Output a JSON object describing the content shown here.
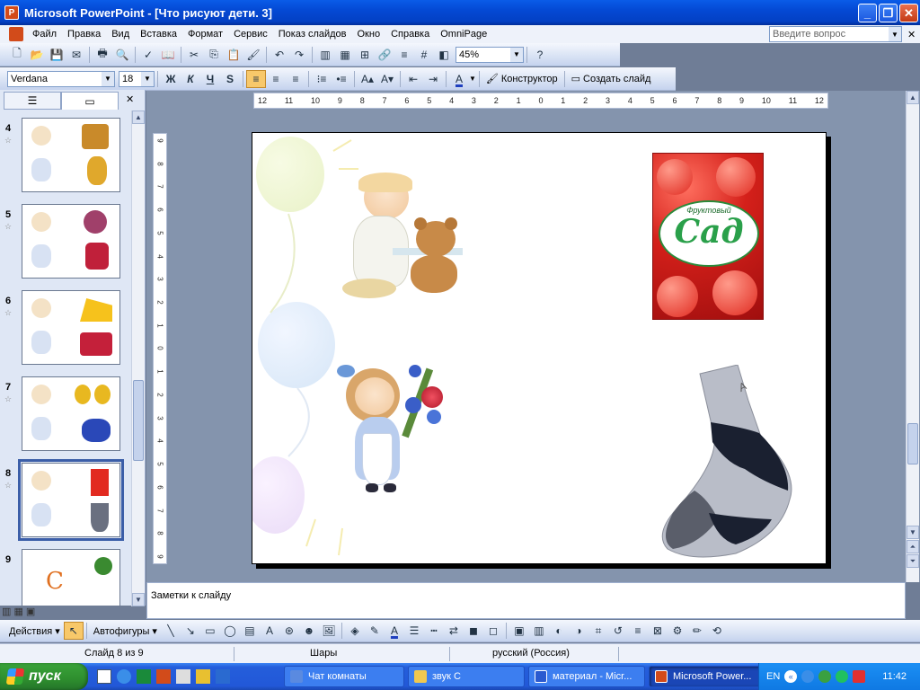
{
  "window": {
    "title": "Microsoft PowerPoint - [Что рисуют дети. 3]"
  },
  "menu": {
    "items": [
      "Файл",
      "Правка",
      "Вид",
      "Вставка",
      "Формат",
      "Сервис",
      "Показ слайдов",
      "Окно",
      "Справка",
      "OmniPage"
    ],
    "help_placeholder": "Введите вопрос"
  },
  "standard_toolbar": {
    "zoom": "45%"
  },
  "format_toolbar": {
    "font": "Verdana",
    "size": "18",
    "bold": "Ж",
    "italic": "К",
    "underline": "Ч",
    "shadow": "S",
    "designer": "Конструктор",
    "new_slide": "Создать слайд"
  },
  "slides": [
    {
      "num": "4"
    },
    {
      "num": "5"
    },
    {
      "num": "6"
    },
    {
      "num": "7"
    },
    {
      "num": "8",
      "selected": true
    },
    {
      "num": "9"
    }
  ],
  "ruler": {
    "h": [
      "12",
      "11",
      "10",
      "9",
      "8",
      "7",
      "6",
      "5",
      "4",
      "3",
      "2",
      "1",
      "0",
      "1",
      "2",
      "3",
      "4",
      "5",
      "6",
      "7",
      "8",
      "9",
      "10",
      "11",
      "12"
    ],
    "v": [
      "9",
      "8",
      "7",
      "6",
      "5",
      "4",
      "3",
      "2",
      "1",
      "0",
      "1",
      "2",
      "3",
      "4",
      "5",
      "6",
      "7",
      "8",
      "9"
    ]
  },
  "slide": {
    "juice_label_small": "Фруктовый",
    "juice_label": "Сад"
  },
  "notes": {
    "placeholder": "Заметки к слайду"
  },
  "draw_toolbar": {
    "actions": "Действия",
    "autoshapes": "Автофигуры"
  },
  "status": {
    "slide": "Слайд 8 из 9",
    "design": "Шары",
    "lang": "русский (Россия)"
  },
  "taskbar": {
    "start": "пуск",
    "tasks": [
      "Чат комнаты",
      "звук С",
      "материал - Micr...",
      "Microsoft Power..."
    ],
    "lang": "EN",
    "clock": "11:42"
  },
  "colors": {
    "title_blue": "#0449d4",
    "taskbar_blue": "#245edb",
    "start_green": "#2e8e2e",
    "slide_bg": "#ffffff"
  }
}
